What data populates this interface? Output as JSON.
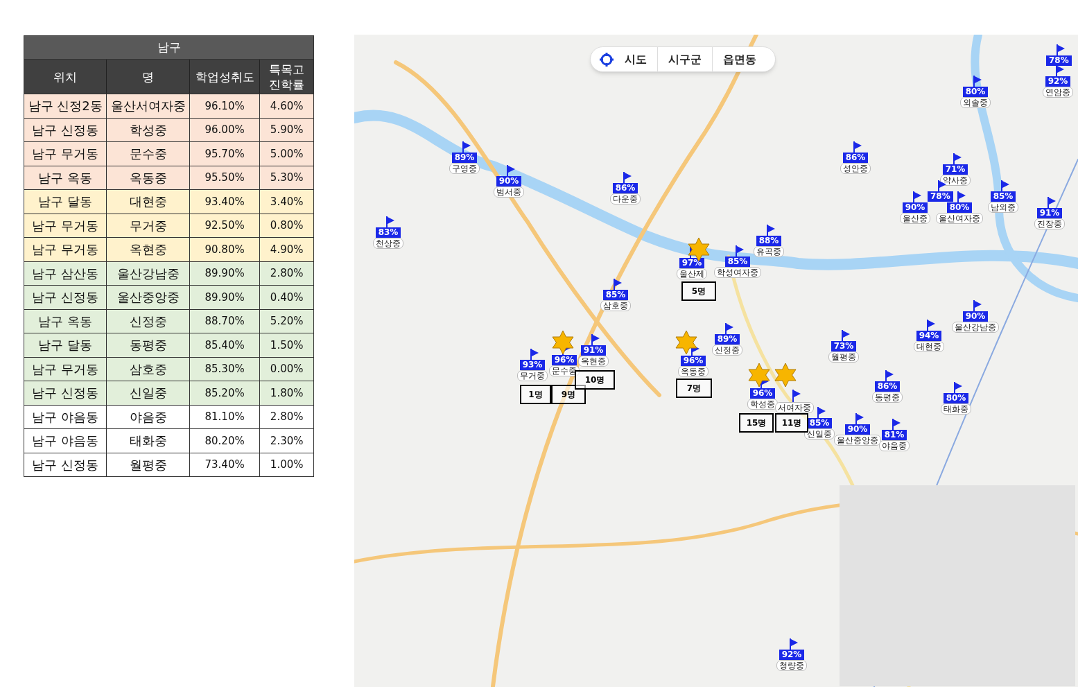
{
  "table": {
    "title": "남구",
    "columns": [
      "위치",
      "명",
      "학업성취도",
      "특목고\n진학률"
    ],
    "rows": [
      {
        "color": "#fce4d6",
        "cells": [
          "남구 신정2동",
          "울산서여자중",
          "96.10%",
          "4.60%"
        ]
      },
      {
        "color": "#fce4d6",
        "cells": [
          "남구 신정동",
          "학성중",
          "96.00%",
          "5.90%"
        ]
      },
      {
        "color": "#fce4d6",
        "cells": [
          "남구 무거동",
          "문수중",
          "95.70%",
          "5.00%"
        ]
      },
      {
        "color": "#fce4d6",
        "cells": [
          "남구 옥동",
          "옥동중",
          "95.50%",
          "5.30%"
        ]
      },
      {
        "color": "#fff2cc",
        "cells": [
          "남구 달동",
          "대현중",
          "93.40%",
          "3.40%"
        ]
      },
      {
        "color": "#fff2cc",
        "cells": [
          "남구 무거동",
          "무거중",
          "92.50%",
          "0.80%"
        ]
      },
      {
        "color": "#fff2cc",
        "cells": [
          "남구 무거동",
          "옥현중",
          "90.80%",
          "4.90%"
        ]
      },
      {
        "color": "#e2efda",
        "cells": [
          "남구 삼산동",
          "울산강남중",
          "89.90%",
          "2.80%"
        ]
      },
      {
        "color": "#e2efda",
        "cells": [
          "남구 신정동",
          "울산중앙중",
          "89.90%",
          "0.40%"
        ]
      },
      {
        "color": "#e2efda",
        "cells": [
          "남구 옥동",
          "신정중",
          "88.70%",
          "5.20%"
        ]
      },
      {
        "color": "#e2efda",
        "cells": [
          "남구 달동",
          "동평중",
          "85.40%",
          "1.50%"
        ]
      },
      {
        "color": "#e2efda",
        "cells": [
          "남구 무거동",
          "삼호중",
          "85.30%",
          "0.00%"
        ]
      },
      {
        "color": "#e2efda",
        "cells": [
          "남구 신정동",
          "신일중",
          "85.20%",
          "1.80%"
        ]
      },
      {
        "color": "#ffffff",
        "cells": [
          "남구 야음동",
          "야음중",
          "81.10%",
          "2.80%"
        ]
      },
      {
        "color": "#ffffff",
        "cells": [
          "남구 야음동",
          "태화중",
          "80.20%",
          "2.30%"
        ]
      },
      {
        "color": "#ffffff",
        "cells": [
          "남구 신정동",
          "월평중",
          "73.40%",
          "1.00%"
        ]
      }
    ]
  },
  "map": {
    "region_tabs": [
      {
        "label": "시도"
      },
      {
        "label": "시구군"
      },
      {
        "label": "읍면동"
      }
    ],
    "markers": [
      {
        "percent": "89%",
        "name": "구영중"
      },
      {
        "percent": "90%",
        "name": "범서중"
      },
      {
        "percent": "86%",
        "name": "다운중"
      },
      {
        "percent": "83%",
        "name": "천상중"
      },
      {
        "percent": "85%",
        "name": "삼호중"
      },
      {
        "percent": "97%",
        "name": "울산제"
      },
      {
        "percent": "85%",
        "name": "학성여자중"
      },
      {
        "percent": "88%",
        "name": "유곡중"
      },
      {
        "percent": "86%",
        "name": "성안중"
      },
      {
        "percent": "71%",
        "name": "약사중"
      },
      {
        "percent": "78%"
      },
      {
        "percent": "90%",
        "name": "울산중"
      },
      {
        "percent": "80%",
        "name": "울산여자중"
      },
      {
        "percent": "85%",
        "name": "남외중"
      },
      {
        "percent": "91%",
        "name": "진장중"
      },
      {
        "percent": "80%",
        "name": "외솔중"
      },
      {
        "percent": "78%"
      },
      {
        "percent": "92%",
        "name": "연암중"
      },
      {
        "percent": "93%",
        "name": "무거중"
      },
      {
        "percent": "96%",
        "name": "문수중"
      },
      {
        "percent": "91%",
        "name": "옥현중"
      },
      {
        "percent": "89%",
        "name": "신정중"
      },
      {
        "percent": "96%",
        "name": "옥동중"
      },
      {
        "percent": "96%",
        "name": "학성중"
      },
      {
        "name": "서여자중"
      },
      {
        "percent": "73%",
        "name": "월평중"
      },
      {
        "percent": "94%",
        "name": "대현중"
      },
      {
        "percent": "90%",
        "name": "울산강남중"
      },
      {
        "percent": "86%",
        "name": "동평중"
      },
      {
        "percent": "80%",
        "name": "태화중"
      },
      {
        "percent": "85%",
        "name": "신일중"
      },
      {
        "percent": "90%",
        "name": "울산중앙중"
      },
      {
        "percent": "81%",
        "name": "야음중"
      },
      {
        "percent": "92%",
        "name": "청량중"
      }
    ],
    "counts": [
      "5명",
      "1명",
      "9명",
      "10명",
      "7명",
      "15명",
      "11명"
    ]
  }
}
